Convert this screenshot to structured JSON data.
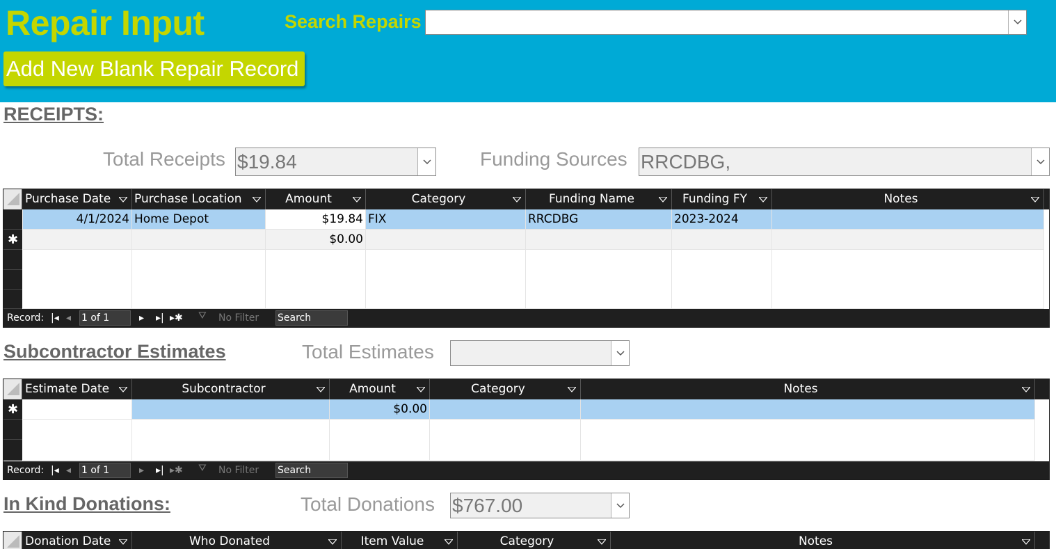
{
  "header": {
    "title": "Repair Input",
    "search_label": "Search Repairs",
    "search_value": "",
    "add_button_label": "Add New Blank Repair Record"
  },
  "receipts": {
    "section_title": "RECEIPTS:",
    "total_label": "Total Receipts",
    "total_value": "$19.84",
    "funding_label": "Funding Sources",
    "funding_value": "RRCDBG,",
    "columns": [
      "Purchase Date",
      "Purchase Location",
      "Amount",
      "Category",
      "Funding Name",
      "Funding FY",
      "Notes"
    ],
    "rows": [
      {
        "purchase_date": "4/1/2024",
        "purchase_location": "Home Depot",
        "amount": "$19.84",
        "category": "FIX",
        "funding_name": "RRCDBG",
        "funding_fy": "2023-2024",
        "notes": ""
      }
    ],
    "new_row_amount": "$0.00",
    "nav": {
      "record_label": "Record:",
      "position": "1 of 1",
      "filter": "No Filter",
      "search": "Search"
    }
  },
  "estimates": {
    "section_title": "Subcontractor Estimates",
    "total_label": "Total Estimates",
    "total_value": "",
    "columns": [
      "Estimate Date",
      "Subcontractor",
      "Amount",
      "Category",
      "Notes"
    ],
    "new_row_amount": "$0.00",
    "nav": {
      "record_label": "Record:",
      "position": "1 of 1",
      "filter": "No Filter",
      "search": "Search"
    }
  },
  "donations": {
    "section_title": "In Kind Donations:",
    "total_label": "Total Donations",
    "total_value": "$767.00",
    "columns": [
      "Donation Date",
      "Who Donated",
      "Item Value",
      "Category",
      "Notes"
    ]
  },
  "icons": {
    "dropdown": "chevron-down-icon",
    "new_record": "asterisk-icon",
    "first": "first-record-icon",
    "prev": "prev-record-icon",
    "next": "next-record-icon",
    "last": "last-record-icon",
    "new": "new-record-icon",
    "filter": "filter-icon"
  },
  "colors": {
    "header_bg": "#00aad6",
    "accent": "#c4d600",
    "selected_row": "#a9d1f2",
    "grid_header": "#1f1f1f"
  }
}
